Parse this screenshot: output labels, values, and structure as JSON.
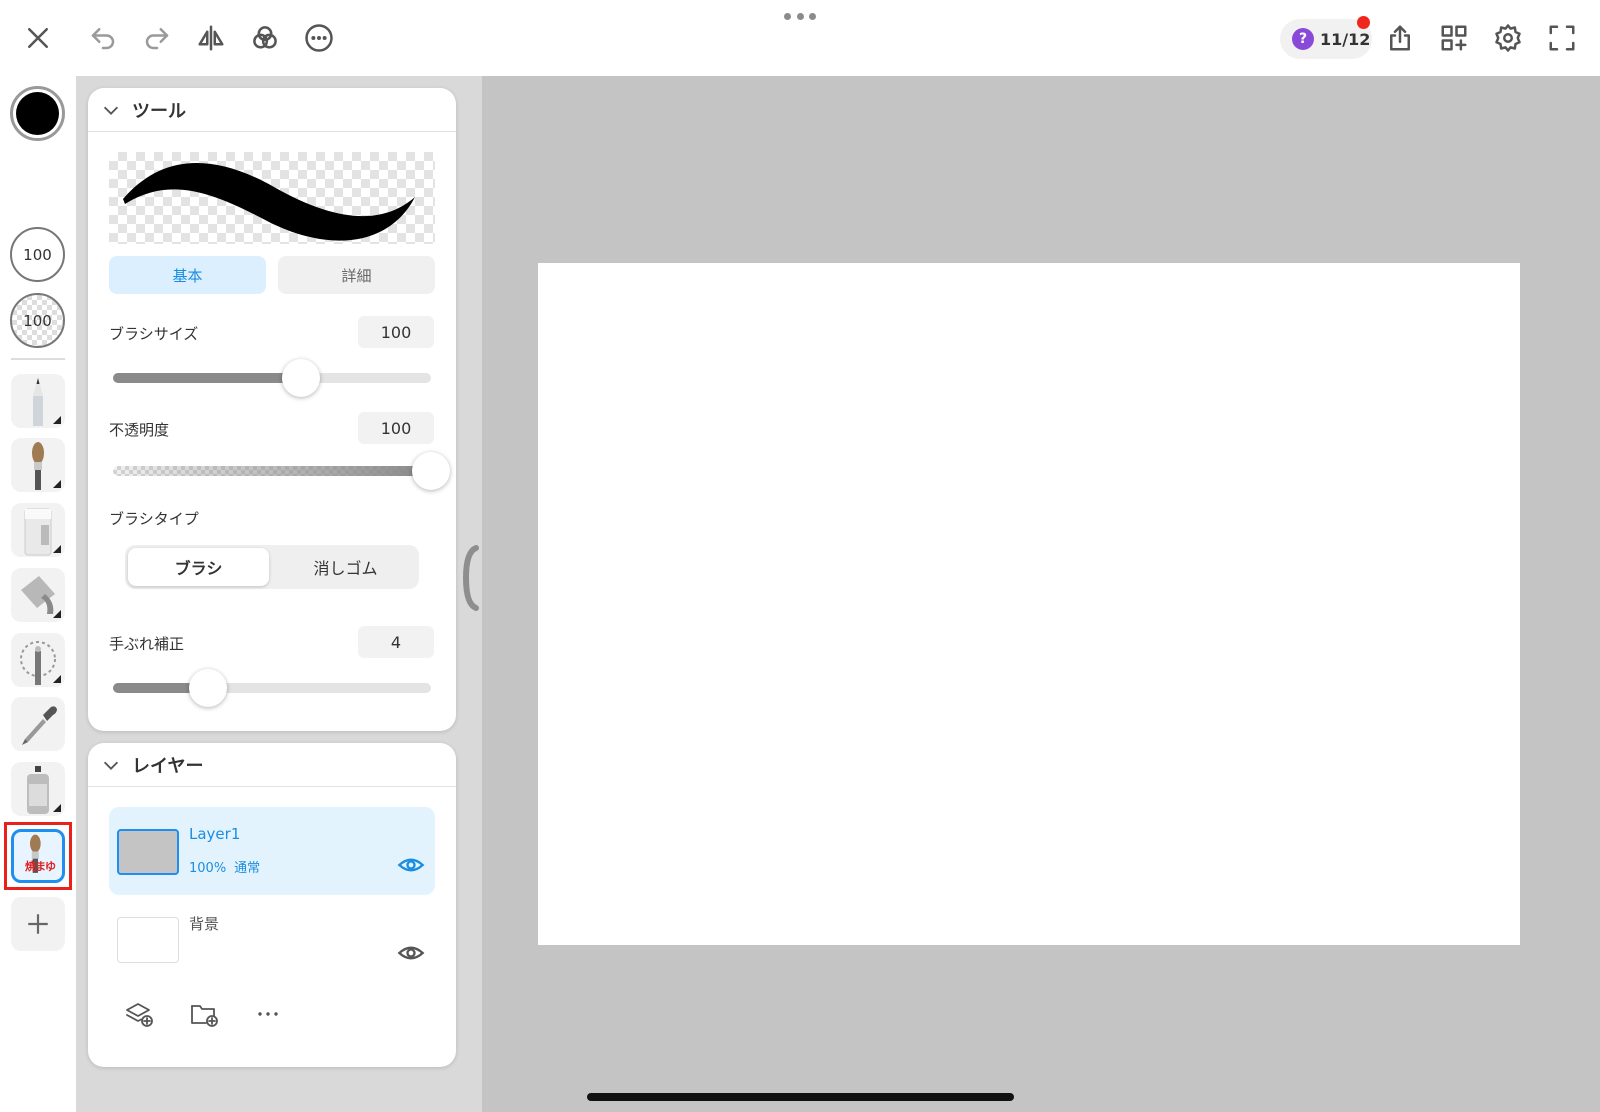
{
  "topbar": {
    "help_count": "11/12",
    "help_symbol": "?",
    "icons": [
      "close-icon",
      "undo-icon",
      "redo-icon",
      "mirror-icon",
      "blend-icon",
      "more-icon",
      "share-icon",
      "layout-icon",
      "settings-icon",
      "fullscreen-icon"
    ]
  },
  "leftcol": {
    "current_color": "#000000",
    "brush_size": "100",
    "brush_opacity": "100",
    "tools": [
      "pencil",
      "brush",
      "eraser",
      "fill-bucket",
      "magic-wand",
      "eyedropper",
      "spray"
    ],
    "custom_brush_label": "焼まゆ"
  },
  "tool_panel": {
    "title": "ツール",
    "tabs": {
      "basic": "基本",
      "detail": "詳細",
      "active": "basic"
    },
    "brush_size": {
      "label": "ブラシサイズ",
      "value": "100",
      "level": 0.59
    },
    "opacity": {
      "label": "不透明度",
      "value": "100",
      "level": 1.0
    },
    "brush_type": {
      "label": "ブラシタイプ",
      "options": [
        "ブラシ",
        "消しゴム"
      ],
      "selected": "ブラシ"
    },
    "stabilizer": {
      "label": "手ぶれ補正",
      "value": "4",
      "level": 0.3
    }
  },
  "layer_panel": {
    "title": "レイヤー",
    "layers": [
      {
        "name": "Layer1",
        "opacity": "100%",
        "blend": "通常",
        "visible": true,
        "selected": true
      },
      {
        "name": "背景",
        "visible": true,
        "selected": false
      }
    ],
    "actions": [
      "add-layer-icon",
      "add-folder-icon",
      "more-icon"
    ]
  },
  "colors": {
    "accent": "#1c8de0",
    "highlight": "#e8221b",
    "workspace": "#c4c4c4",
    "canvas": "#ffffff"
  }
}
